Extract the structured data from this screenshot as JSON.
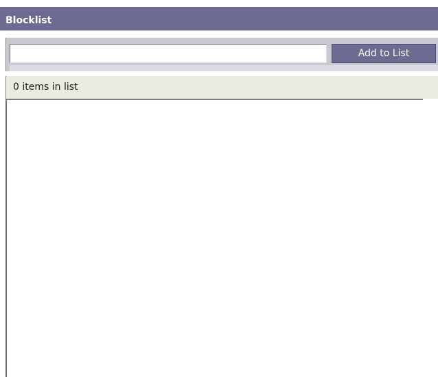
{
  "panel": {
    "title": "Blocklist"
  },
  "toolbar": {
    "input_value": "",
    "add_button_label": "Add to List"
  },
  "status": {
    "text": "0 items in list"
  },
  "list": {
    "items": []
  },
  "colors": {
    "header_bg": "#6e6b93",
    "button_bg": "#6e6b93",
    "status_bg": "#ecebe1"
  }
}
